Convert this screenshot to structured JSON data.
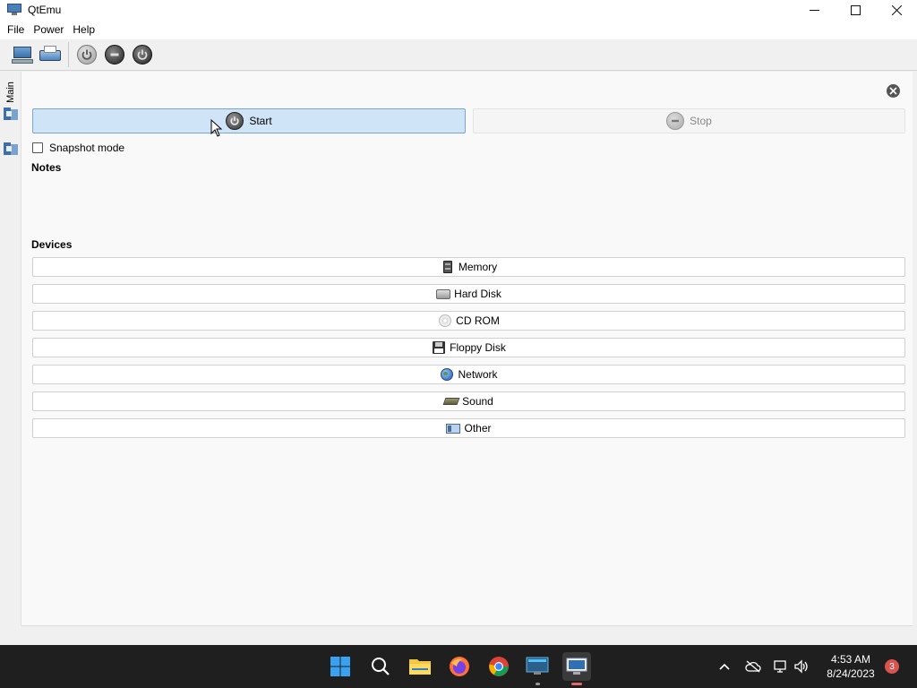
{
  "window": {
    "title": "QtEmu",
    "app_icon": "monitor-icon",
    "controls": [
      "minimize-icon",
      "maximize-icon",
      "close-icon"
    ]
  },
  "menu": {
    "items": [
      "File",
      "Power",
      "Help"
    ]
  },
  "toolbar": {
    "buttons": [
      "new-machine-icon",
      "settings-icon",
      "power-on-icon",
      "power-off-icon",
      "reset-icon"
    ]
  },
  "sidebar": {
    "tab_label": "Main",
    "tabs": [
      "machine-icon",
      "machine-icon"
    ]
  },
  "main": {
    "start_label": "Start",
    "stop_label": "Stop",
    "snapshot_label": "Snapshot mode",
    "snapshot_checked": false,
    "notes_heading": "Notes",
    "notes_text": "",
    "devices_heading": "Devices",
    "devices": [
      {
        "label": "Memory",
        "icon": "memory-chip-icon"
      },
      {
        "label": "Hard Disk",
        "icon": "hard-disk-icon"
      },
      {
        "label": "CD ROM",
        "icon": "cd-rom-icon"
      },
      {
        "label": "Floppy Disk",
        "icon": "floppy-disk-icon"
      },
      {
        "label": "Network",
        "icon": "globe-icon"
      },
      {
        "label": "Sound",
        "icon": "sound-card-icon"
      },
      {
        "label": "Other",
        "icon": "other-device-icon"
      }
    ]
  },
  "taskbar": {
    "apps": [
      "windows-start-icon",
      "search-icon",
      "file-explorer-icon",
      "firefox-icon",
      "chrome-icon",
      "terminal-icon",
      "qtemu-icon"
    ],
    "tray": [
      "chevron-up-icon",
      "cloud-offline-icon",
      "network-icon",
      "volume-icon"
    ],
    "time": "4:53 AM",
    "date": "8/24/2023",
    "notification_count": "3"
  },
  "colors": {
    "start_button_bg": "#cfe4f7",
    "start_button_border": "#7aa6d4",
    "taskbar_bg": "#1f1f1f",
    "badge": "#d9534f"
  }
}
